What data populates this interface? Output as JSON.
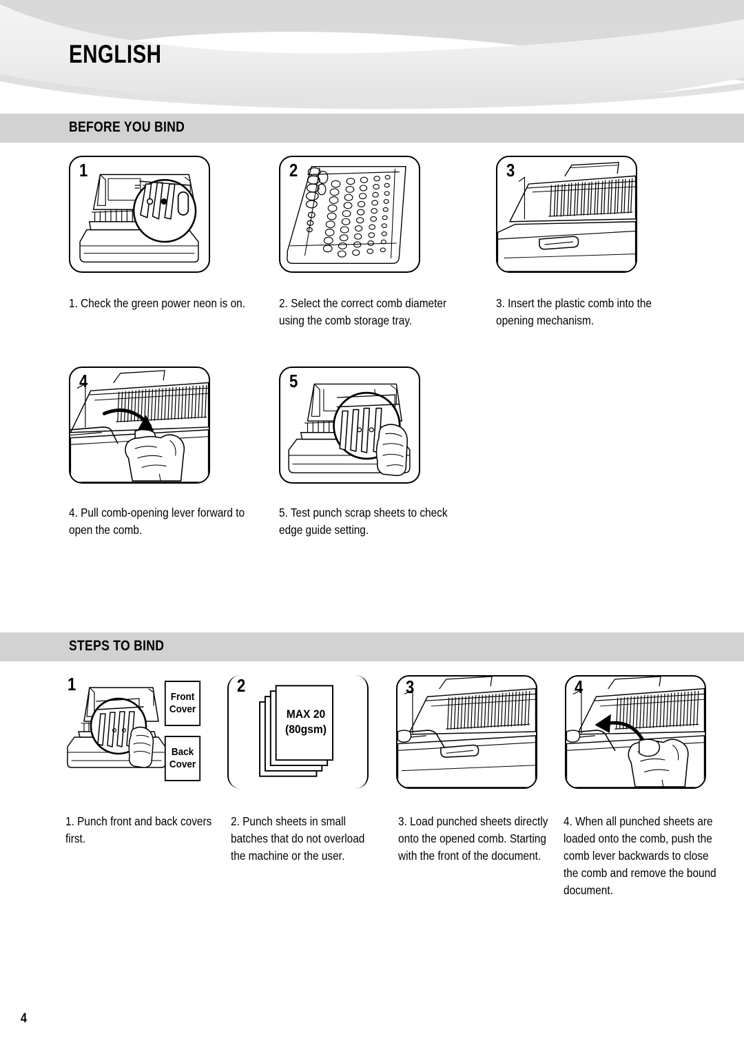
{
  "document": {
    "language_title": "ENGLISH",
    "page_number": "4"
  },
  "theme": {
    "band_gray": "#d2d2d2",
    "swoosh_gray_dark": "#d6d6d6",
    "swoosh_gray_light": "#ececec",
    "ink": "#000000",
    "paper": "#ffffff"
  },
  "sections": [
    {
      "id": "before-you-bind",
      "heading": "BEFORE YOU BIND",
      "steps": [
        {
          "number": "1",
          "caption": "1. Check the green power neon is on.",
          "illustration": "comb-binder-with-magnifier-on-power-neon"
        },
        {
          "number": "2",
          "caption": "2. Select the correct comb diameter\nusing the comb storage tray.",
          "illustration": "comb-storage-tray-with-plastic-combs"
        },
        {
          "number": "3",
          "caption": "3. Insert the plastic comb into the\nopening mechanism.",
          "illustration": "comb-opening-mechanism-with-teeth"
        },
        {
          "number": "4",
          "caption": "4. Pull comb-opening lever forward to\nopen the comb.",
          "illustration": "hand-pulling-lever-forward-with-arrow"
        },
        {
          "number": "5",
          "caption": "5. Test punch scrap sheets to check\nedge guide setting.",
          "illustration": "magnifier-on-punch-slots-with-hand"
        }
      ]
    },
    {
      "id": "steps-to-bind",
      "heading": "STEPS TO BIND",
      "steps": [
        {
          "number": "1",
          "caption": "1. Punch front and back covers\nfirst.",
          "illustration": "binder-with-magnifier-and-cover-sheets",
          "labels": {
            "front_cover": "Front\nCover",
            "back_cover": "Back\nCover"
          }
        },
        {
          "number": "2",
          "caption": "2. Punch sheets in small\nbatches that do not overload\nthe machine or the user.",
          "illustration": "stack-of-sheets-with-max-label",
          "sheet_label": "MAX 20\n(80gsm)"
        },
        {
          "number": "3",
          "caption": "3. Load punched sheets directly\nonto the opened comb. Starting\nwith the front of the document.",
          "illustration": "opened-comb-ready-for-sheets"
        },
        {
          "number": "4",
          "caption": "4. When all punched sheets are\nloaded onto the comb, push the\ncomb lever backwards to close\nthe comb and remove the bound\ndocument.",
          "illustration": "hand-pushing-lever-backwards-with-arrow"
        }
      ]
    }
  ]
}
